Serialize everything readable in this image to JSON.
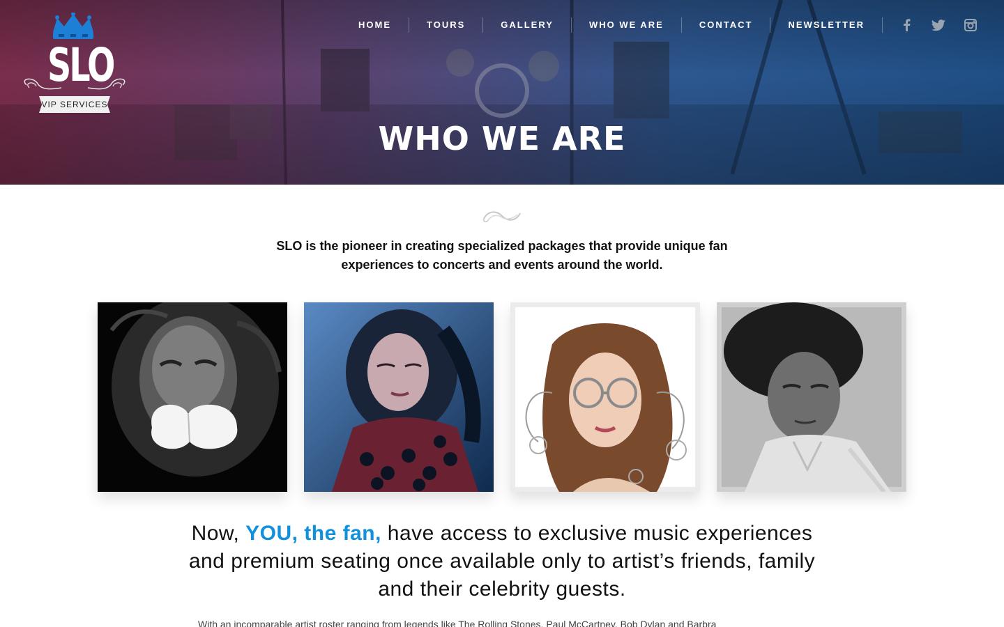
{
  "brand": {
    "logo_text": "SLO",
    "ribbon_text": "VIP SERVICES",
    "crown_color": "#1e7fd6"
  },
  "nav": {
    "items": [
      {
        "label": "HOME"
      },
      {
        "label": "TOURS"
      },
      {
        "label": "GALLERY"
      },
      {
        "label": "WHO WE ARE"
      },
      {
        "label": "CONTACT"
      },
      {
        "label": "NEWSLETTER"
      }
    ],
    "social": [
      "facebook-icon",
      "twitter-icon",
      "instagram-icon"
    ]
  },
  "hero": {
    "title": "WHO WE ARE"
  },
  "intro": {
    "text": "SLO is the pioneer in creating specialized packages that provide unique fan experiences to concerts and events around the world."
  },
  "gallery": {
    "photos": [
      {
        "style": "black-and-white"
      },
      {
        "style": "blue-tone"
      },
      {
        "style": "color-on-white"
      },
      {
        "style": "black-and-white"
      }
    ]
  },
  "headline": {
    "before": "Now, ",
    "accent": "YOU, the fan,",
    "after": " have access to exclusive music experiences and premium seating once available only to artist’s friends, family and their celebrity guests."
  },
  "body": {
    "text": "With an incomparable artist roster ranging from legends like The Rolling Stones, Paul McCartney, Bob Dylan and Barbra"
  },
  "colors": {
    "accent": "#1190dc",
    "hero_left": "#7a2d4c",
    "hero_right": "#1f4f86"
  }
}
